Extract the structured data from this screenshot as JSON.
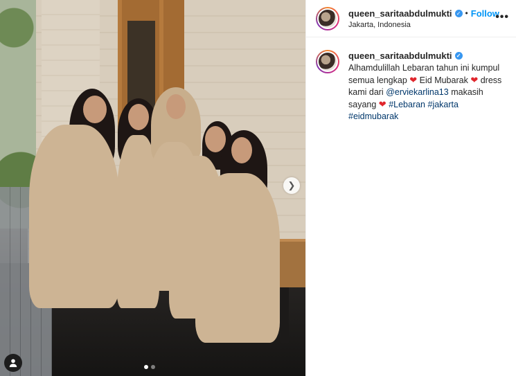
{
  "post": {
    "carousel": {
      "total_slides": 2,
      "active_slide": 1
    }
  },
  "header": {
    "username": "queen_saritaabdulmukti",
    "separator": "•",
    "follow_label": "Follow",
    "location": "Jakarta, Indonesia",
    "more_icon": "more-horizontal-icon"
  },
  "caption": {
    "username": "queen_saritaabdulmukti",
    "line1": "Alhamdulillah Lebaran tahun ini kumpul semua lengkap",
    "line2": "Eid Mubarak",
    "line3": "dress kami dari",
    "mention": "@erviekarlina13",
    "line4": "makasih sayang",
    "hashtags": "#Lebaran #jakarta #eidmubarak"
  },
  "colors": {
    "accent": "#0095f6",
    "verified": "#3897f0",
    "heart": "#e0262d",
    "link": "#00376b"
  }
}
